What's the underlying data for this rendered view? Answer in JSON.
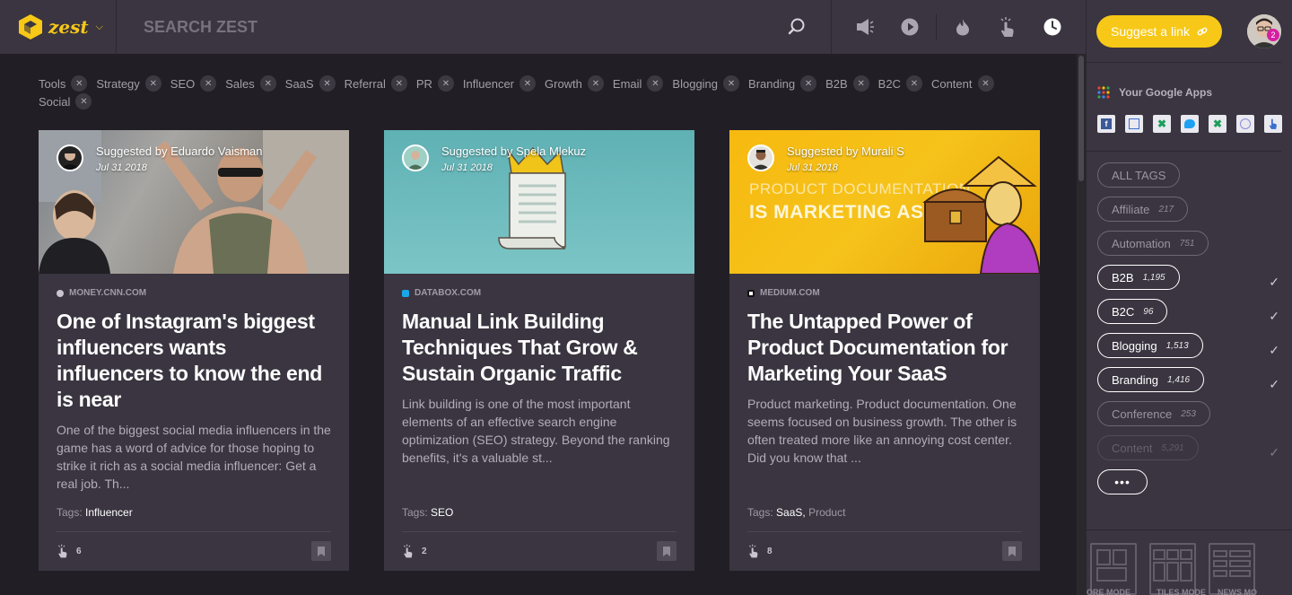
{
  "app": {
    "logo_text": "zest"
  },
  "search": {
    "placeholder": "SEARCH ZEST"
  },
  "sidebar": {
    "suggest_label": "Suggest a link",
    "notification_count": "2",
    "apps_title": "Your Google Apps",
    "tags": [
      {
        "label": "ALL TAGS",
        "count": "",
        "active": false,
        "checked": false
      },
      {
        "label": "Affiliate",
        "count": "217",
        "active": false,
        "checked": false
      },
      {
        "label": "Automation",
        "count": "751",
        "active": false,
        "checked": false
      },
      {
        "label": "B2B",
        "count": "1,195",
        "active": true,
        "checked": true
      },
      {
        "label": "B2C",
        "count": "96",
        "active": true,
        "checked": true
      },
      {
        "label": "Blogging",
        "count": "1,513",
        "active": true,
        "checked": true
      },
      {
        "label": "Branding",
        "count": "1,416",
        "active": true,
        "checked": true
      },
      {
        "label": "Conference",
        "count": "253",
        "active": false,
        "checked": false
      },
      {
        "label": "Content",
        "count": "5,291",
        "active": false,
        "checked": true
      }
    ],
    "more_label": "•••",
    "modes": [
      "ORE MODE",
      "TILES MODE",
      "NEWS MO"
    ]
  },
  "filters": [
    "Tools",
    "Strategy",
    "SEO",
    "Sales",
    "SaaS",
    "Referral",
    "PR",
    "Influencer",
    "Growth",
    "Email",
    "Blogging",
    "Branding",
    "B2B",
    "B2C",
    "Content",
    "Social"
  ],
  "cards": [
    {
      "suggested_by": "Suggested by Eduardo Vaisman",
      "date": "Jul 31 2018",
      "source": "MONEY.CNN.COM",
      "title": "One of Instagram's biggest influencers wants influencers to know the end is near",
      "desc": "One of the biggest social media influencers in the game has a word of advice for those hoping to strike it rich as a social media influencer: Get a real job. Th...",
      "tags_label": "Tags:",
      "tags": "Influencer",
      "tags_extra": "",
      "zests": "6"
    },
    {
      "suggested_by": "Suggested by Spela Mlekuz",
      "date": "Jul 31 2018",
      "source": "DATABOX.COM",
      "title": "Manual Link Building Techniques That Grow & Sustain Organic Traffic",
      "desc": "Link building is one of the most important elements of an effective search engine optimization (SEO) strategy. Beyond the ranking benefits, it's a valuable st...",
      "tags_label": "Tags:",
      "tags": "SEO",
      "tags_extra": "",
      "zests": "2"
    },
    {
      "suggested_by": "Suggested by Murali S",
      "date": "Jul 31 2018",
      "source": "MEDIUM.COM",
      "title": "The Untapped Power of Product Documentation for Marketing Your SaaS",
      "desc": "Product marketing. Product documentation. One seems focused on business growth. The other is often treated more like an annoying cost center. Did you know that ...",
      "tags_label": "Tags:",
      "tags": "SaaS,",
      "tags_extra": "Product",
      "zests": "8",
      "image_text_1": "PRODUCT DOCUMENTATION",
      "image_text_2": "IS MARKETING ASSET"
    }
  ],
  "colors": {
    "accent": "#f7c817",
    "panel": "#3a3540",
    "background": "#211f25"
  }
}
